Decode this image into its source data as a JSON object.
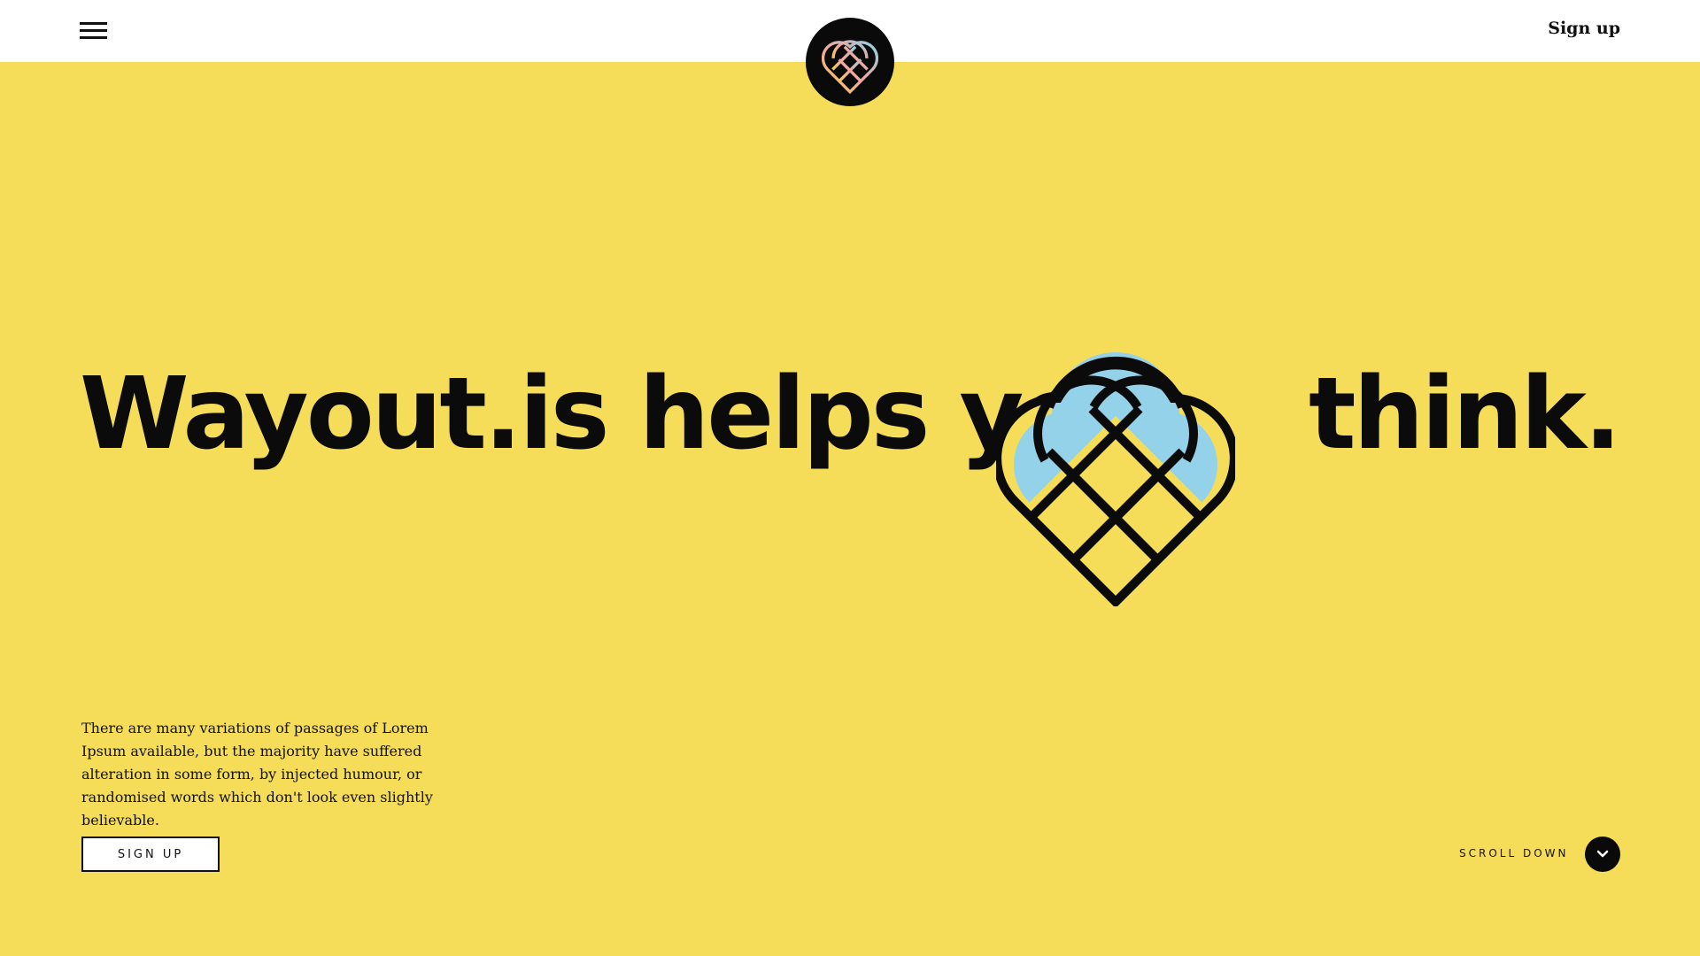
{
  "header": {
    "signup_label": "Sign up",
    "menu_icon": "hamburger-menu-icon",
    "logo_icon": "wayout-logo-icon"
  },
  "hero": {
    "headline_left": "Wayout.is helps you",
    "headline_right": "think.",
    "description": "There are many variations of passages of Lorem Ipsum available, but the majority have suffered alteration in some form, by injected humour, or randomised words which don't look even slightly believable.",
    "signup_button_label": "SIGN UP",
    "scroll_label": "SCROLL DOWN",
    "scroll_icon": "chevron-down-icon",
    "mark_icon": "wayout-mark-icon"
  },
  "colors": {
    "hero_background": "#f5dd59",
    "header_background": "#ffffff",
    "text": "#0b0b0b",
    "mark_fill": "#94d2ea",
    "logo_gradient": [
      "#f3c95a",
      "#f2a7a0",
      "#8ed3e6"
    ]
  }
}
